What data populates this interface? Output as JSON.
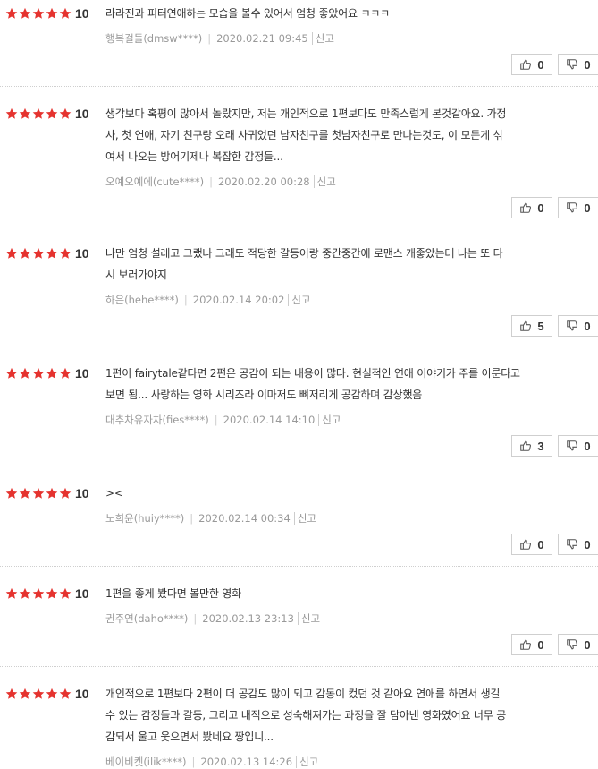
{
  "colors": {
    "star": "#e5332f",
    "text": "#333333",
    "meta": "#999999",
    "border": "#cfcfcf"
  },
  "reviews": [
    {
      "stars": 5,
      "score": "10",
      "lines": [
        "라라진과 피터연애하는 모습을 볼수 있어서 엄청 좋았어요 ㅋㅋㅋ"
      ],
      "author": "행복걸들(dmsw****)",
      "date": "2020.02.21 09:45",
      "report": "신고",
      "likes": "0",
      "dislikes": "0"
    },
    {
      "stars": 5,
      "score": "10",
      "lines": [
        "생각보다 혹평이 많아서 놀랐지만, 저는 개인적으로 1편보다도 만족스럽게 본것같아요. 가정",
        "사, 첫 연애, 자기 친구랑 오래 사귀었던 남자친구를 첫남자친구로 만나는것도, 이 모든게 섞",
        "여서 나오는 방어기제나 복잡한 감정들..."
      ],
      "author": "오예오예에(cute****)",
      "date": "2020.02.20 00:28",
      "report": "신고",
      "likes": "0",
      "dislikes": "0"
    },
    {
      "stars": 5,
      "score": "10",
      "lines": [
        "나만 엄청 설레고 그랬나 그래도 적당한 갈등이랑 중간중간에 로맨스 개좋았는데 나는 또 다",
        "시 보러가야지"
      ],
      "author": "하은(hehe****)",
      "date": "2020.02.14 20:02",
      "report": "신고",
      "likes": "5",
      "dislikes": "0"
    },
    {
      "stars": 5,
      "score": "10",
      "lines": [
        "1편이 fairytale같다면 2편은 공감이 되는 내용이 많다. 현실적인 연애 이야기가 주를 이룬다고",
        "보면 됨... 사랑하는 영화 시리즈라 이마저도 뼈저리게 공감하며 감상했음"
      ],
      "author": "대추차유자차(fies****)",
      "date": "2020.02.14 14:10",
      "report": "신고",
      "likes": "3",
      "dislikes": "0"
    },
    {
      "stars": 5,
      "score": "10",
      "lines": [
        "><"
      ],
      "author": "노희윤(huiy****)",
      "date": "2020.02.14 00:34",
      "report": "신고",
      "likes": "0",
      "dislikes": "0"
    },
    {
      "stars": 5,
      "score": "10",
      "lines": [
        "1편을 좋게 봤다면 볼만한 영화"
      ],
      "author": "권주연(daho****)",
      "date": "2020.02.13 23:13",
      "report": "신고",
      "likes": "0",
      "dislikes": "0"
    },
    {
      "stars": 5,
      "score": "10",
      "lines": [
        "개인적으로 1편보다 2편이 더 공감도 많이 되고 감동이 컸던 것 같아요 연애를 하면서 생길",
        "수 있는 감정들과 갈등, 그리고 내적으로 성숙해져가는 과정을 잘 담아낸 영화였어요 너무 공",
        "감되서 울고 웃으면서 봤네요 짱입니..."
      ],
      "author": "베이비켓(ilik****)",
      "date": "2020.02.13 14:26",
      "report": "신고",
      "likes": "",
      "dislikes": ""
    }
  ]
}
